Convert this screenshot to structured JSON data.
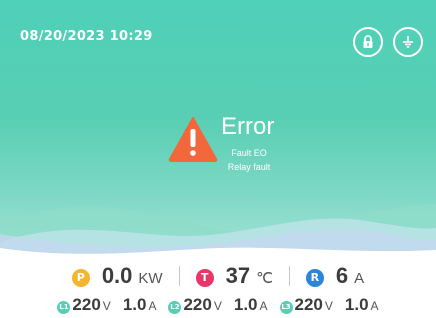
{
  "header": {
    "datetime": "08/20/2023  10:29",
    "lock_icon": "lock-icon",
    "ground_icon": "ground-icon"
  },
  "alert": {
    "title": "Error",
    "code": "Fault EO",
    "description": "Relay fault",
    "icon": "warning-icon",
    "icon_color": "#f2683a"
  },
  "stats": {
    "power": {
      "badge": "P",
      "value": "0.0",
      "unit": "KW",
      "color": "#f5b52e"
    },
    "temperature": {
      "badge": "T",
      "value": "37",
      "unit": "℃",
      "color": "#e8356a"
    },
    "rcd": {
      "badge": "R",
      "value": "6",
      "unit": "A",
      "color": "#2c85d6"
    }
  },
  "phases": [
    {
      "badge": "L1",
      "voltage": "220",
      "voltage_unit": "V",
      "current": "1.0",
      "current_unit": "A"
    },
    {
      "badge": "L2",
      "voltage": "220",
      "voltage_unit": "V",
      "current": "1.0",
      "current_unit": "A"
    },
    {
      "badge": "L3",
      "voltage": "220",
      "voltage_unit": "V",
      "current": "1.0",
      "current_unit": "A"
    }
  ],
  "colors": {
    "primary": "#58cfb4",
    "background": "#ffffff"
  }
}
